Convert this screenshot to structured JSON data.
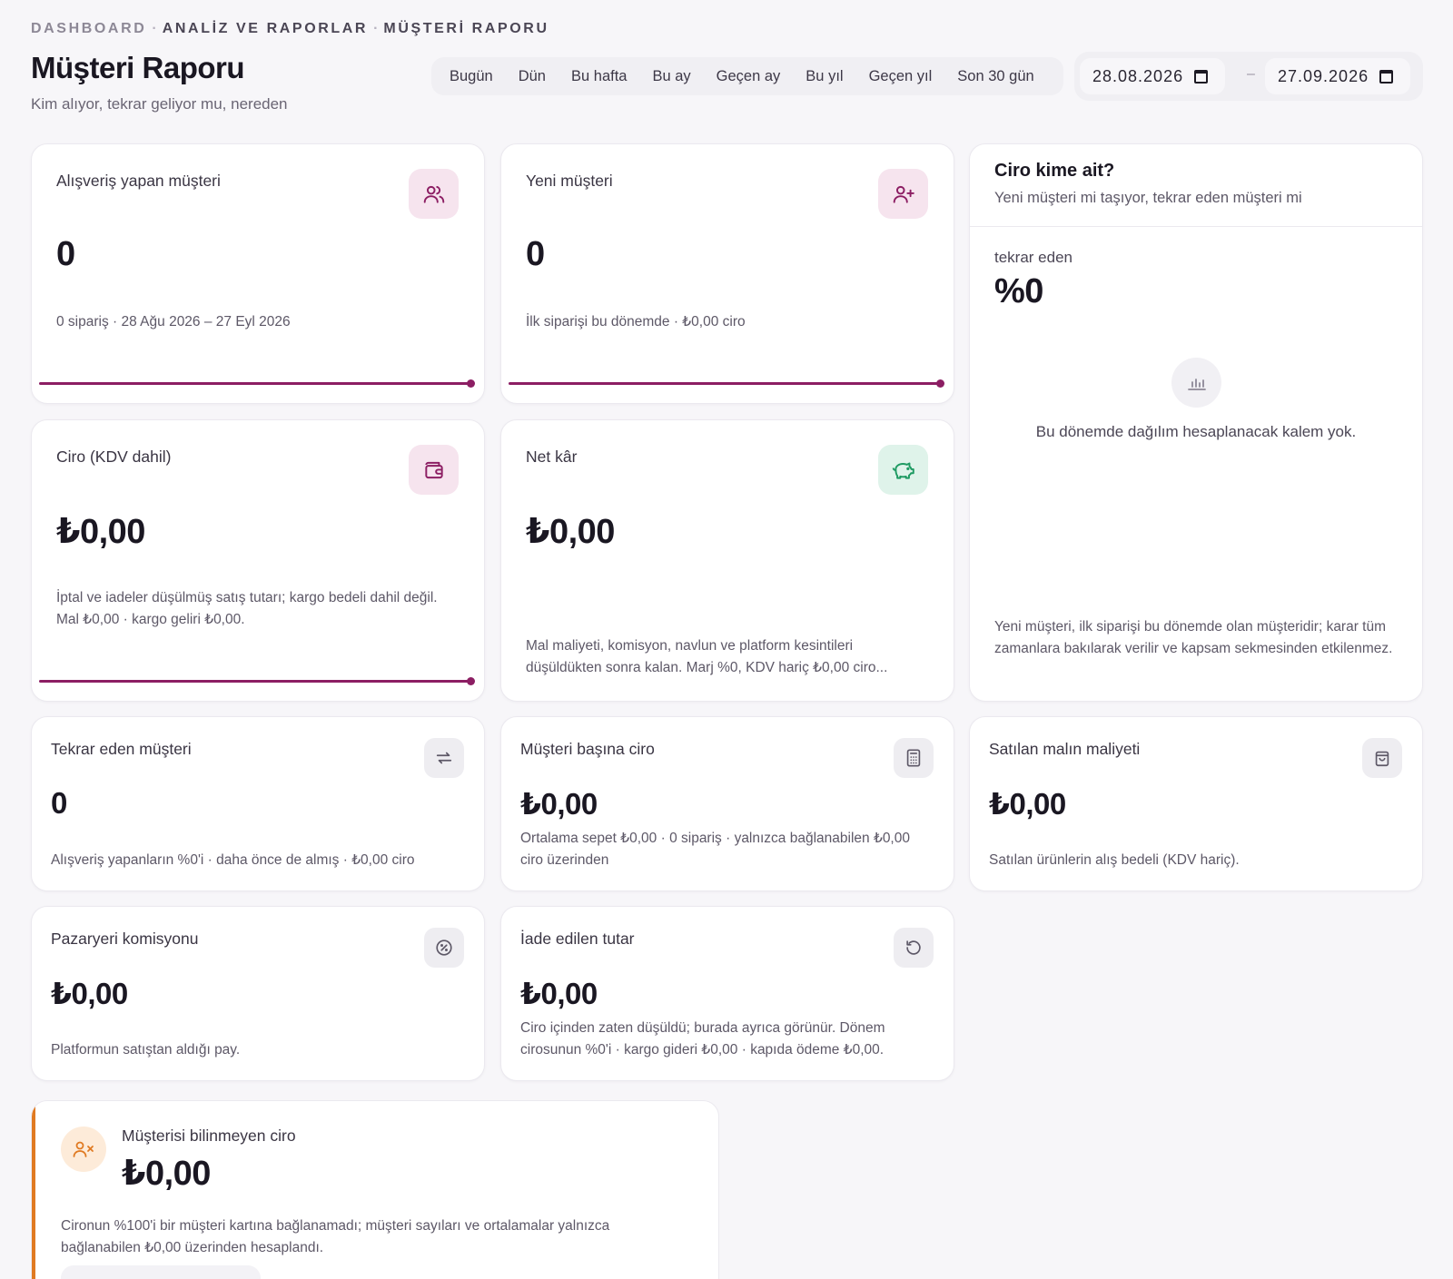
{
  "breadcrumb": {
    "items": [
      "DASHBOARD",
      "ANALİZ VE RAPORLAR",
      "MÜŞTERİ RAPORU"
    ],
    "separator": "·"
  },
  "header": {
    "title": "Müşteri Raporu",
    "subtitle": "Kim alıyor, tekrar geliyor mu, nereden"
  },
  "range_presets": [
    "Bugün",
    "Dün",
    "Bu hafta",
    "Bu ay",
    "Geçen ay",
    "Bu yıl",
    "Geçen yıl",
    "Son 30 gün"
  ],
  "date_range": {
    "start": "28.08.2026",
    "end": "27.09.2026",
    "separator": "–"
  },
  "cards": {
    "shoppers": {
      "label": "Alışveriş yapan müşteri",
      "value": "0",
      "desc": "0 sipariş · 28 Ağu 2026 – 27 Eyl 2026",
      "icon": "users-icon",
      "progress": 1.0
    },
    "new_customers": {
      "label": "Yeni müşteri",
      "value": "0",
      "desc": "İlk siparişi bu dönemde · ₺0,00 ciro",
      "icon": "user-plus-icon",
      "progress": 1.0
    },
    "revenue": {
      "label": "Ciro (KDV dahil)",
      "value": "₺0,00",
      "desc": "İptal ve iadeler düşülmüş satış tutarı; kargo bedeli dahil değil. Mal ₺0,00 · kargo geliri ₺0,00.",
      "icon": "wallet-icon",
      "progress": 1.0
    },
    "net_profit": {
      "label": "Net kâr",
      "value": "₺0,00",
      "desc": "Mal maliyeti, komisyon, navlun ve platform kesintileri düşüldükten sonra kalan. Marj %0, KDV hariç ₺0,00 ciro...",
      "icon": "piggy-bank-icon"
    },
    "repeat_customers": {
      "label": "Tekrar eden müşteri",
      "value": "0",
      "desc": "Alışveriş yapanların %0'i · daha önce de almış · ₺0,00 ciro",
      "icon": "repeat-icon"
    },
    "revenue_per_customer": {
      "label": "Müşteri başına ciro",
      "value": "₺0,00",
      "desc": "Ortalama sepet ₺0,00 · 0 sipariş · yalnızca bağlanabilen ₺0,00 ciro üzerinden",
      "icon": "calculator-icon"
    },
    "cogs": {
      "label": "Satılan malın maliyeti",
      "value": "₺0,00",
      "desc": "Satılan ürünlerin alış bedeli (KDV hariç).",
      "icon": "shopping-bag-icon"
    },
    "commission": {
      "label": "Pazaryeri komisyonu",
      "value": "₺0,00",
      "desc": "Platformun satıştan aldığı pay.",
      "icon": "percent-badge-icon"
    },
    "refunds": {
      "label": "İade edilen tutar",
      "value": "₺0,00",
      "desc": "Ciro içinden zaten düşüldü; burada ayrıca görünür. Dönem cirosunun %0'i · kargo gideri ₺0,00 · kapıda ödeme ₺0,00.",
      "icon": "undo-icon"
    }
  },
  "split_card": {
    "title": "Ciro kime ait?",
    "subtitle": "Yeni müşteri mi taşıyor, tekrar eden müşteri mi",
    "metric_label": "tekrar eden",
    "metric_value": "%0",
    "empty_text": "Bu dönemde dağılım hesaplanacak kalem yok.",
    "empty_icon": "bar-chart-icon",
    "footnote": "Yeni müşteri, ilk siparişi bu dönemde olan müşteridir; karar tüm zamanlara bakılarak verilir ve kapsam sekmesinden etkilenmez."
  },
  "unknown_card": {
    "label": "Müşterisi bilinmeyen ciro",
    "value": "₺0,00",
    "desc": "Cironun %100'i bir müşteri kartına bağlanamadı; müşteri sayıları ve ortalamalar yalnızca bağlanabilen ₺0,00 üzerinden hesaplandı.",
    "icon": "user-x-icon"
  },
  "colors": {
    "brand": "#8c1e63",
    "warning": "#e07a22",
    "success": "#1e9a62"
  }
}
